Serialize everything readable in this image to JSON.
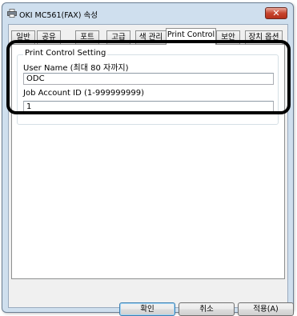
{
  "window": {
    "title": "OKI MC561(FAX) 속성",
    "close_label": "✕"
  },
  "tabs": [
    {
      "label": "일반"
    },
    {
      "label": "공유"
    },
    {
      "label": "포트"
    },
    {
      "label": "고급"
    },
    {
      "label": "색 관리"
    },
    {
      "label": "Print Control",
      "selected": true
    },
    {
      "label": "보안"
    },
    {
      "label": "장치 옵션"
    }
  ],
  "print_control": {
    "group_title": "Print Control Setting",
    "user_name_label": "User Name (최대 80 자까지)",
    "user_name_value": "ODC",
    "job_account_label": "Job Account ID (1-999999999)",
    "job_account_value": "1"
  },
  "buttons": {
    "ok": "확인",
    "cancel": "취소",
    "apply": "적용(A)"
  },
  "colors": {
    "frame": "#cfdfee",
    "close_button": "#c7452e",
    "highlight": "#000000"
  }
}
